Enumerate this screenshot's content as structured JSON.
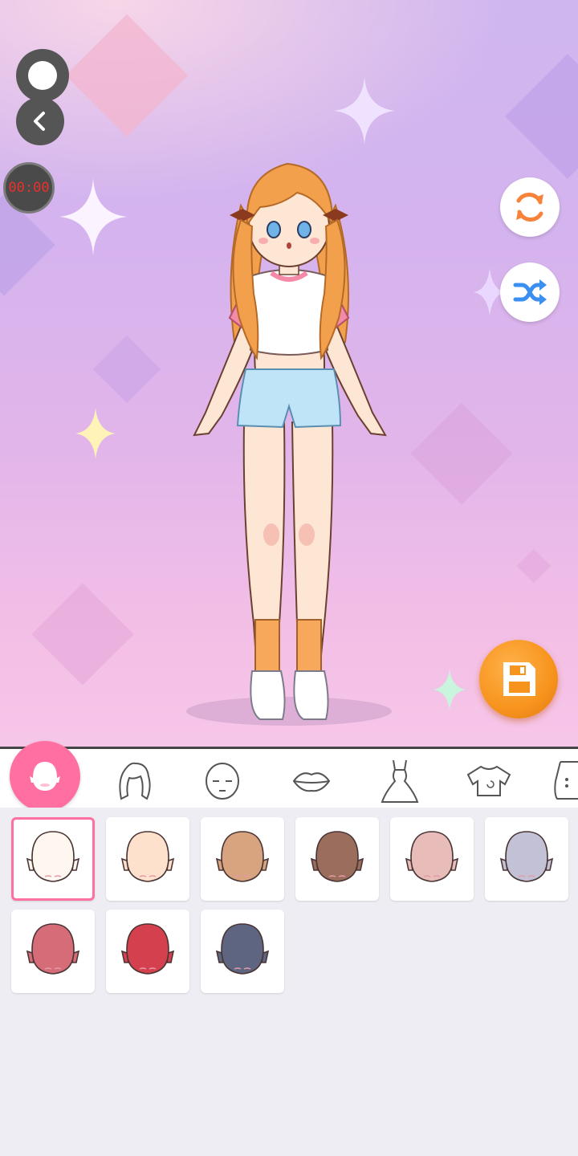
{
  "timer": {
    "text": "00:00",
    "color": "#e8312a"
  },
  "controls": {
    "record_button_icon": "record-dot-icon",
    "back_button_icon": "chevron-left-icon",
    "reset_button_icon": "refresh-icon",
    "random_button_icon": "shuffle-icon",
    "save_button_icon": "floppy-disk-icon"
  },
  "colors": {
    "accent_pink": "#ff6fa2",
    "refresh_orange": "#f7833a",
    "shuffle_blue": "#3a8ff0",
    "save_orange": "#f7941d"
  },
  "category_tabs": [
    {
      "name": "body",
      "icon": "body-head-icon",
      "selected": true
    },
    {
      "name": "hair",
      "icon": "hair-icon",
      "selected": false
    },
    {
      "name": "face",
      "icon": "face-icon",
      "selected": false
    },
    {
      "name": "mouth",
      "icon": "lips-icon",
      "selected": false
    },
    {
      "name": "dress",
      "icon": "dress-icon",
      "selected": false
    },
    {
      "name": "top",
      "icon": "shirt-icon",
      "selected": false
    },
    {
      "name": "more",
      "icon": "partial-icon",
      "selected": false
    }
  ],
  "skin_tones": [
    {
      "color": "#fdf7ef",
      "selected": true
    },
    {
      "color": "#fde1cc",
      "selected": false
    },
    {
      "color": "#d7a47f",
      "selected": false
    },
    {
      "color": "#9b6d5c",
      "selected": false
    },
    {
      "color": "#e7bcb9",
      "selected": false
    },
    {
      "color": "#c3c1d6",
      "selected": false
    },
    {
      "color": "#d66c78",
      "selected": false
    },
    {
      "color": "#d5404f",
      "selected": false
    },
    {
      "color": "#5d6580",
      "selected": false
    }
  ]
}
